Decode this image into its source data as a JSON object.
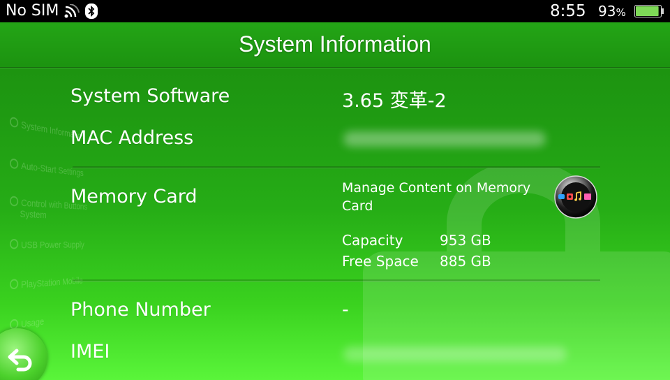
{
  "status_bar": {
    "carrier": "No SIM",
    "time": "8:55",
    "battery_percent": "93",
    "battery_unit": "%",
    "battery_level": 0.93,
    "icons": [
      "wifi-signal-icon",
      "bluetooth-icon",
      "battery-icon"
    ]
  },
  "header": {
    "title": "System Information"
  },
  "rows": {
    "system_software": {
      "label": "System Software",
      "value": "3.65 変革-2"
    },
    "mac_address": {
      "label": "MAC Address"
    },
    "memory_card": {
      "label": "Memory Card",
      "manage_link": "Manage Content on Memory Card",
      "capacity_label": "Capacity",
      "capacity_value": "953 GB",
      "free_space_label": "Free Space",
      "free_space_value": "885 GB"
    },
    "phone_number": {
      "label": "Phone Number",
      "value": "-"
    },
    "imei": {
      "label": "IMEI"
    }
  },
  "background_menu": {
    "items": [
      "System Information",
      "Auto-Start Settings",
      "Control with Buttons",
      "System",
      "USB Power Supply",
      "PlayStation Mobile",
      "Usage"
    ]
  },
  "colors": {
    "accent": "#26ad16",
    "status_bar": "#000000",
    "battery": "#7ed957"
  }
}
